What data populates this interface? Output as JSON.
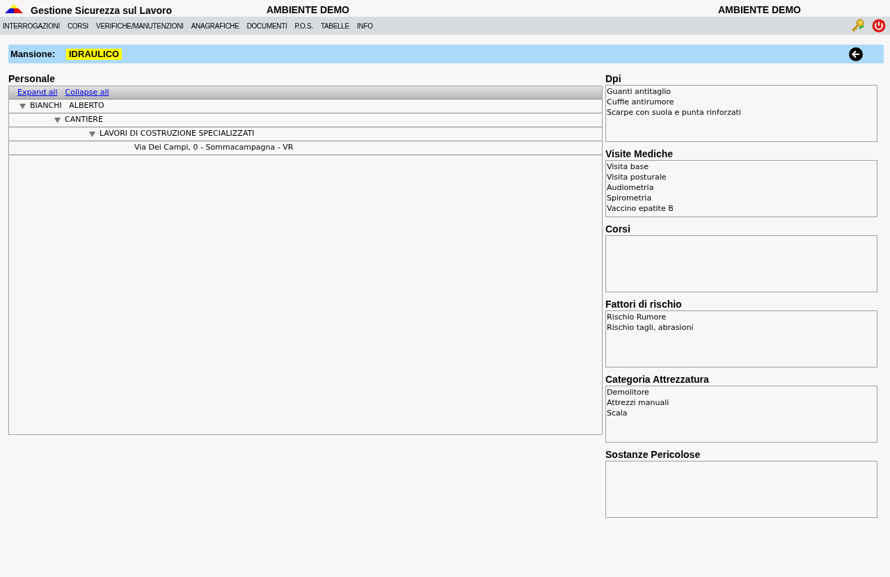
{
  "header": {
    "title": "Gestione Sicurezza sul Lavoro",
    "environment_labels": [
      "AMBIENTE DEMO",
      "AMBIENTE DEMO"
    ]
  },
  "menu": [
    "INTERROGAZIONI",
    "CORSI",
    "VERIFICHE/MANUTENZIONI",
    "ANAGRAFICHE",
    "DOCUMENTI",
    "P.O.S.",
    "TABELLE",
    "INFO"
  ],
  "mansione": {
    "label": "Mansione:",
    "value": "IDRAULICO"
  },
  "personale": {
    "title": "Personale",
    "links": [
      "Expand all",
      "Collapse all"
    ],
    "tree": [
      {
        "label": "BIANCHI   ALBERTO",
        "expanded": true,
        "children": [
          {
            "label": "CANTIERE",
            "expanded": true,
            "children": [
              {
                "label": "LAVORI DI COSTRUZIONE SPECIALIZZATI",
                "expanded": true,
                "children": [
                  {
                    "label": "Via Dei Campi, 0 - Sommacampagna - VR"
                  }
                ]
              }
            ]
          }
        ]
      }
    ]
  },
  "sections": [
    {
      "title": "Dpi",
      "items": [
        "Guanti antitaglio",
        "Cuffie antirumore",
        "Scarpe con suola e punta rinforzati"
      ]
    },
    {
      "title": "Visite Mediche",
      "items": [
        "Visita base",
        "Visita posturale",
        "Audiometria",
        "Spirometria",
        "Vaccino epatite B"
      ]
    },
    {
      "title": "Corsi"
    },
    {
      "title": "Fattori di rischio",
      "items": [
        "Rischio Rumore",
        "Rischio tagli, abrasioni"
      ]
    },
    {
      "title": "Categoria Attrezzatura",
      "items": [
        "Demolitore",
        "Attrezzi manuali",
        "Scala"
      ]
    },
    {
      "title": "Sostanze Pericolose"
    }
  ]
}
